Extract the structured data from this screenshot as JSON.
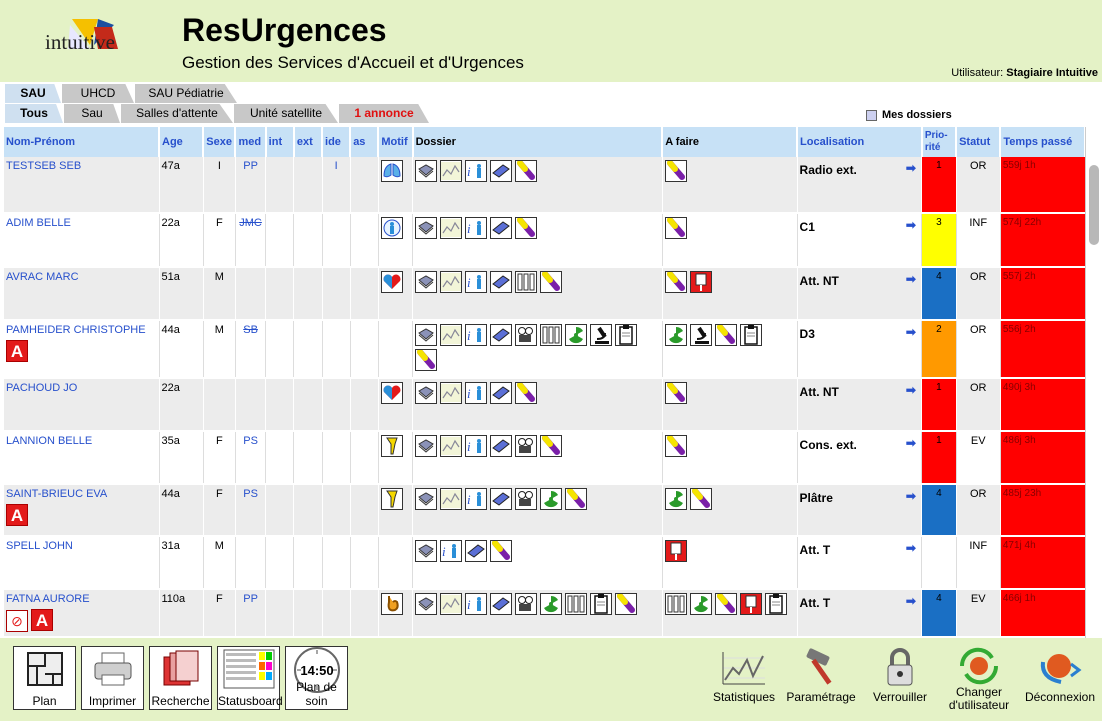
{
  "app": {
    "title": "ResUrgences",
    "subtitle": "Gestion des Services d'Accueil et d'Urgences",
    "logo_text": "intuitive",
    "user_label": "Utilisateur:",
    "user_name": "Stagiaire Intuitive"
  },
  "tabs_top": [
    {
      "label": "SAU",
      "active": true
    },
    {
      "label": "UHCD",
      "active": false
    },
    {
      "label": "SAU Pédiatrie",
      "active": false
    }
  ],
  "tabs_sub": [
    {
      "label": "Tous",
      "active": true
    },
    {
      "label": "Sau",
      "active": false
    },
    {
      "label": "Salles d'attente",
      "active": false
    },
    {
      "label": "Unité satellite",
      "active": false
    },
    {
      "label": "1 annonce",
      "alert": true
    }
  ],
  "mes_dossiers": "Mes dossiers",
  "columns": {
    "nom": "Nom-Prénom",
    "age": "Age",
    "sexe": "Sexe",
    "med": "med",
    "int": "int",
    "ext": "ext",
    "ide": "ide",
    "as": "as",
    "motif": "Motif",
    "dossier": "Dossier",
    "afaire": "A faire",
    "localisation": "Localisation",
    "priorite": "Prio-rité",
    "statut": "Statut",
    "temps": "Temps passé"
  },
  "colors": {
    "prio1": "#ff0000",
    "prio2": "#ff9900",
    "prio3": "#ffff00",
    "prio4": "#1a6fc4",
    "time_bg": "#ff0000",
    "header_bg": "#c7e1f6",
    "link": "#2750cc"
  },
  "patients": [
    {
      "name": "TESTSEB SEB",
      "age": "47a",
      "sexe": "I",
      "med": "PP",
      "med_strike": false,
      "ide": "I",
      "motif": "lungs-icon",
      "dossier": [
        "book-icon",
        "chart-icon",
        "info-icon",
        "notepad-icon",
        "vial-icon"
      ],
      "afaire": [
        "vial-icon"
      ],
      "loc": "Radio ext.",
      "prio": "1",
      "prio_color": "#ff0000",
      "statut": "OR",
      "temps": "559j 1h",
      "badge_a": false,
      "badge_no": false
    },
    {
      "name": "ADIM BELLE",
      "age": "22a",
      "sexe": "F",
      "med": "JMC",
      "med_strike": true,
      "ide": "",
      "motif": "person-icon",
      "dossier": [
        "book-icon",
        "chart-icon",
        "info-icon",
        "notepad-icon",
        "vial-icon"
      ],
      "afaire": [
        "vial-icon"
      ],
      "loc": "C1",
      "prio": "3",
      "prio_color": "#ffff00",
      "statut": "INF",
      "temps": "574j 22h",
      "badge_a": false,
      "badge_no": false
    },
    {
      "name": "AVRAC MARC",
      "age": "51a",
      "sexe": "M",
      "med": "",
      "med_strike": false,
      "ide": "",
      "motif": "heart-icon",
      "dossier": [
        "book-icon",
        "chart-icon",
        "info-icon",
        "notepad-icon",
        "tubes-icon",
        "vial-icon"
      ],
      "afaire": [
        "vial-icon",
        "iv-bag-icon"
      ],
      "loc": "Att. NT",
      "prio": "4",
      "prio_color": "#1a6fc4",
      "statut": "OR",
      "temps": "557j 2h",
      "badge_a": false,
      "badge_no": false
    },
    {
      "name": "PAMHEIDER CHRISTOPHE",
      "age": "44a",
      "sexe": "M",
      "med": "SB",
      "med_strike": true,
      "ide": "",
      "motif": "",
      "dossier": [
        "book-icon",
        "chart-icon",
        "info-icon",
        "notepad-icon",
        "camera-icon",
        "tubes-icon",
        "radiation-icon",
        "microscope-icon",
        "clipboard-icon",
        "vial-icon"
      ],
      "afaire": [
        "radiation-icon",
        "microscope-icon",
        "vial-icon",
        "clipboard-icon"
      ],
      "loc": "D3",
      "prio": "2",
      "prio_color": "#ff9900",
      "statut": "OR",
      "temps": "556j 2h",
      "badge_a": true,
      "badge_no": false
    },
    {
      "name": "PACHOUD JO",
      "age": "22a",
      "sexe": "",
      "med": "",
      "med_strike": false,
      "ide": "",
      "motif": "heart-icon",
      "dossier": [
        "book-icon",
        "chart-icon",
        "info-icon",
        "notepad-icon",
        "vial-icon"
      ],
      "afaire": [
        "vial-icon"
      ],
      "loc": "Att. NT",
      "prio": "1",
      "prio_color": "#ff0000",
      "statut": "OR",
      "temps": "490j 3h",
      "badge_a": false,
      "badge_no": false
    },
    {
      "name": "LANNION BELLE",
      "age": "35a",
      "sexe": "F",
      "med": "PS",
      "med_strike": false,
      "ide": "",
      "motif": "bone-icon",
      "dossier": [
        "book-icon",
        "chart-icon",
        "info-icon",
        "notepad-icon",
        "camera-icon",
        "vial-icon"
      ],
      "afaire": [
        "vial-icon"
      ],
      "loc": "Cons. ext.",
      "prio": "1",
      "prio_color": "#ff0000",
      "statut": "EV",
      "temps": "486j 3h",
      "badge_a": false,
      "badge_no": false
    },
    {
      "name": "SAINT-BRIEUC EVA",
      "age": "44a",
      "sexe": "F",
      "med": "PS",
      "med_strike": false,
      "ide": "",
      "motif": "bone-icon",
      "dossier": [
        "book-icon",
        "chart-icon",
        "info-icon",
        "notepad-icon",
        "camera-icon",
        "radiation-icon",
        "vial-icon"
      ],
      "afaire": [
        "radiation-icon",
        "vial-icon"
      ],
      "loc": "Plâtre",
      "prio": "4",
      "prio_color": "#1a6fc4",
      "statut": "OR",
      "temps": "485j 23h",
      "badge_a": true,
      "badge_no": false
    },
    {
      "name": "SPELL JOHN",
      "age": "31a",
      "sexe": "M",
      "med": "",
      "med_strike": false,
      "ide": "",
      "motif": "",
      "dossier": [
        "book-icon",
        "info-icon",
        "notepad-icon",
        "vial-icon"
      ],
      "afaire": [
        "iv-bag-icon"
      ],
      "loc": "Att. T",
      "prio": "",
      "prio_color": "#ffffff",
      "statut": "INF",
      "temps": "471j 4h",
      "badge_a": false,
      "badge_no": false
    },
    {
      "name": "FATNA AURORE",
      "age": "110a",
      "sexe": "F",
      "med": "PP",
      "med_strike": false,
      "ide": "",
      "motif": "stomach-icon",
      "dossier": [
        "book-icon",
        "chart-icon",
        "info-icon",
        "notepad-icon",
        "camera-icon",
        "radiation-icon",
        "tubes-icon",
        "clipboard-icon",
        "vial-icon"
      ],
      "afaire": [
        "tubes-icon",
        "radiation-icon",
        "vial-icon",
        "iv-bag-icon",
        "clipboard-icon"
      ],
      "loc": "Att. T",
      "prio": "4",
      "prio_color": "#1a6fc4",
      "statut": "EV",
      "temps": "466j 1h",
      "badge_a": true,
      "badge_no": true
    }
  ],
  "footer_left": [
    {
      "label": "Plan",
      "icon": "floorplan-icon"
    },
    {
      "label": "Imprimer",
      "icon": "printer-icon"
    },
    {
      "label": "Recherche",
      "icon": "folders-icon"
    },
    {
      "label": "Statusboard",
      "icon": "statusboard-icon"
    },
    {
      "label": "Plan de soin",
      "icon": "clock-icon",
      "clock": "14:50"
    }
  ],
  "footer_right": [
    {
      "label": "Statistiques",
      "icon": "chart-icon"
    },
    {
      "label": "Paramétrage",
      "icon": "hammer-icon"
    },
    {
      "label": "Verrouiller",
      "icon": "lock-icon"
    },
    {
      "label": "Changer d'utilisateur",
      "icon": "switch-user-icon"
    },
    {
      "label": "Déconnexion",
      "icon": "logout-icon"
    }
  ]
}
